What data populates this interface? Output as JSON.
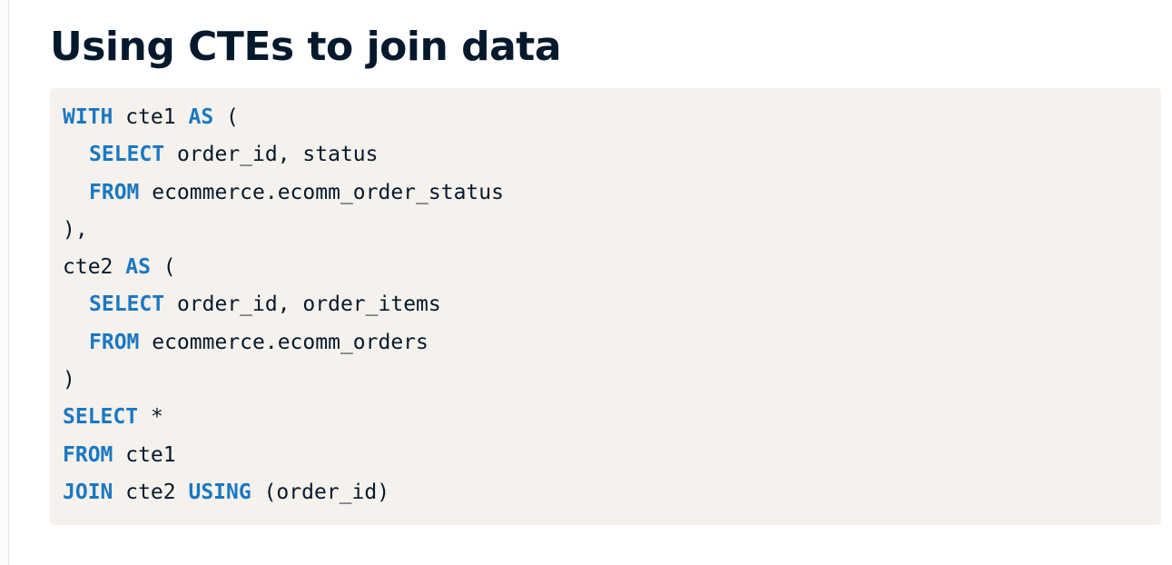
{
  "page": {
    "title": "Using CTEs to join data"
  },
  "code": {
    "language": "sql",
    "keyword_color": "#1a78c2",
    "text_color": "#05192d",
    "background_color": "#f5f1ec",
    "lines": [
      [
        {
          "t": "WITH",
          "k": true
        },
        {
          "t": " cte1 "
        },
        {
          "t": "AS",
          "k": true
        },
        {
          "t": " ("
        }
      ],
      [
        {
          "t": "SELECT",
          "k": true,
          "i": true
        },
        {
          "t": " order_id, status"
        }
      ],
      [
        {
          "t": "FROM",
          "k": true,
          "i": true
        },
        {
          "t": " ecommerce.ecomm_order_status"
        }
      ],
      [
        {
          "t": "),"
        }
      ],
      [
        {
          "t": "cte2 "
        },
        {
          "t": "AS",
          "k": true
        },
        {
          "t": " ("
        }
      ],
      [
        {
          "t": "SELECT",
          "k": true,
          "i": true
        },
        {
          "t": " order_id, order_items"
        }
      ],
      [
        {
          "t": "FROM",
          "k": true,
          "i": true
        },
        {
          "t": " ecommerce.ecomm_orders"
        }
      ],
      [
        {
          "t": ")"
        }
      ],
      [
        {
          "t": "SELECT",
          "k": true
        },
        {
          "t": " *"
        }
      ],
      [
        {
          "t": "FROM",
          "k": true
        },
        {
          "t": " cte1"
        }
      ],
      [
        {
          "t": "JOIN",
          "k": true
        },
        {
          "t": " cte2 "
        },
        {
          "t": "USING",
          "k": true
        },
        {
          "t": " (order_id)"
        }
      ]
    ]
  }
}
